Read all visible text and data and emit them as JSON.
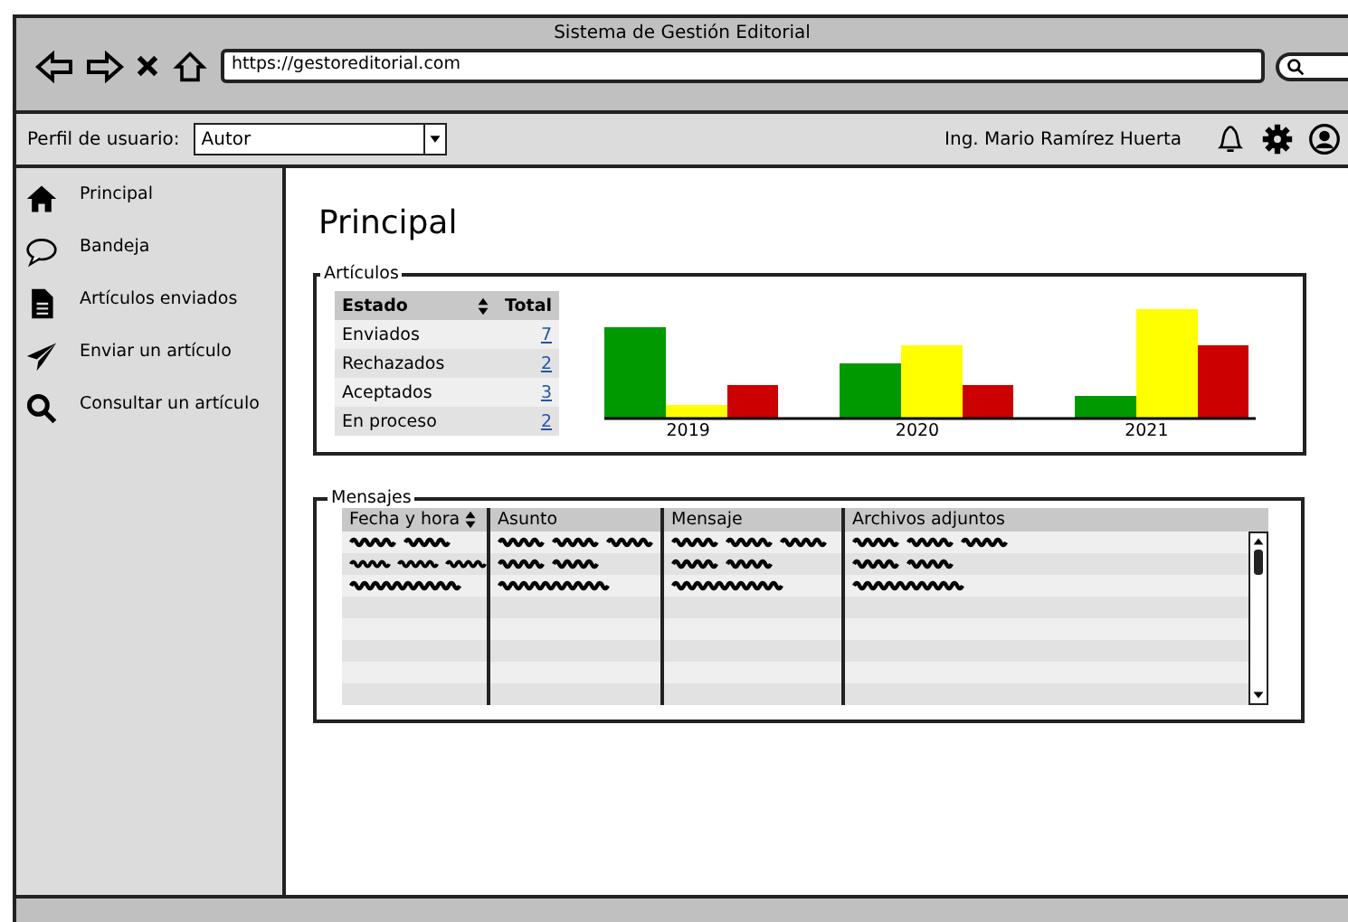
{
  "window": {
    "title": "Sistema de Gestión Editorial",
    "url": "https://gestoreditorial.com"
  },
  "toolbar": {
    "profile_label": "Perfil de usuario:",
    "profile_value": "Autor",
    "user_name": "Ing. Mario Ramírez Huerta"
  },
  "sidebar": {
    "items": [
      {
        "label": "Principal"
      },
      {
        "label": "Bandeja"
      },
      {
        "label": "Artículos enviados"
      },
      {
        "label": "Enviar un artículo"
      },
      {
        "label": "Consultar un artículo"
      }
    ]
  },
  "page_title": "Principal",
  "articles": {
    "title": "Artículos",
    "columns": [
      "Estado",
      "Total"
    ],
    "rows": [
      {
        "estado": "Enviados",
        "total": "7"
      },
      {
        "estado": "Rechazados",
        "total": "2"
      },
      {
        "estado": "Aceptados",
        "total": "3"
      },
      {
        "estado": "En proceso",
        "total": "2"
      }
    ],
    "chart_years": [
      "2019",
      "2020",
      "2021"
    ]
  },
  "messages": {
    "title": "Mensajes",
    "columns": [
      "Fecha y hora",
      "Asunto",
      "Mensaje",
      "Archivos adjuntos"
    ]
  }
}
